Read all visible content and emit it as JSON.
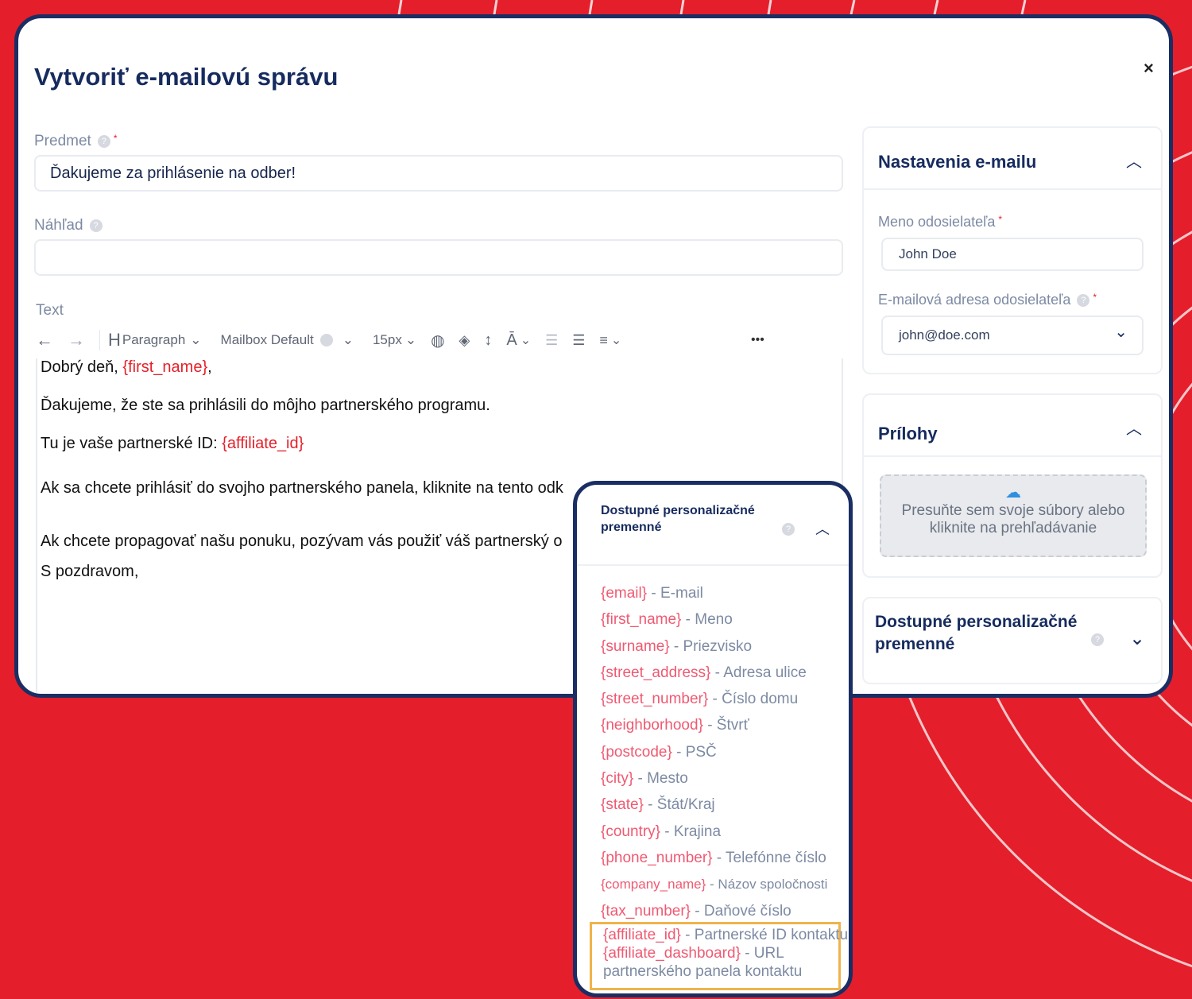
{
  "modal": {
    "title": "Vytvoriť e-mailovú správu",
    "close_symbol": "×"
  },
  "subject": {
    "label": "Predmet",
    "value": "Ďakujeme za prihlásenie na odber!"
  },
  "preview": {
    "label": "Náhľad",
    "value": ""
  },
  "text_editor": {
    "label": "Text",
    "toolbar": {
      "heading_icon": "H",
      "paragraph_label": "Paragraph",
      "font_label": "Mailbox Default",
      "size_label": "15px",
      "more_symbol": "•••"
    },
    "lines": {
      "l1_prefix": "Dobrý deň, ",
      "l1_var": "{first_name}",
      "l1_suffix": ",",
      "l2": "Ďakujeme, že ste sa prihlásili do môjho partnerského programu.",
      "l3_prefix": "Tu je vaše partnerské ID: ",
      "l3_var": "{affiliate_id}",
      "l4": "Ak sa chcete prihlásiť do svojho partnerského panela, kliknite na tento odk",
      "l5": "Ak chcete propagovať našu ponuku, pozývam vás použiť váš partnerský o",
      "l6": "S pozdravom,"
    }
  },
  "email_settings": {
    "title": "Nastavenia e-mailu",
    "sender_name_label": "Meno odosielateľa",
    "sender_name_value": "John Doe",
    "sender_email_label": "E-mailová adresa odosielateľa",
    "sender_email_value": "john@doe.com"
  },
  "attachments": {
    "title": "Prílohy",
    "dropzone_line1": "Presuňte sem svoje súbory alebo",
    "dropzone_line2": "kliknite na prehľadávanie"
  },
  "personalization_card": {
    "title_line1": "Dostupné personalizačné",
    "title_line2": "premenné"
  },
  "popup": {
    "title": "Dostupné personalizačné premenné",
    "variables": [
      {
        "key": "{email}",
        "desc": " - E-mail"
      },
      {
        "key": "{first_name}",
        "desc": " - Meno"
      },
      {
        "key": "{surname}",
        "desc": " - Priezvisko"
      },
      {
        "key": "{street_address}",
        "desc": " - Adresa ulice"
      },
      {
        "key": "{street_number}",
        "desc": " - Číslo domu"
      },
      {
        "key": "{neighborhood}",
        "desc": " - Štvrť"
      },
      {
        "key": "{postcode}",
        "desc": " - PSČ"
      },
      {
        "key": "{city}",
        "desc": " - Mesto"
      },
      {
        "key": "{state}",
        "desc": " - Štát/Kraj"
      },
      {
        "key": "{country}",
        "desc": " - Krajina"
      },
      {
        "key": "{phone_number}",
        "desc": " - Telefónne číslo"
      },
      {
        "key": "{company_name}",
        "desc": " - Názov spoločnosti"
      },
      {
        "key": "{tax_number}",
        "desc": " - Daňové číslo"
      }
    ],
    "highlighted": {
      "affiliate_id_key": "{affiliate_id}",
      "affiliate_id_desc": " - Partnerské ID kontaktu",
      "affiliate_dashboard_key": "{affiliate_dashboard}",
      "affiliate_dashboard_desc": " - URL",
      "affiliate_dashboard_desc2": "partnerského panela kontaktu"
    }
  },
  "colors": {
    "background": "#e41e2b",
    "navy": "#1a2e63",
    "variable_red": "#e4202a",
    "variable_pink": "#ef5a72",
    "highlight": "#f0b34a"
  }
}
